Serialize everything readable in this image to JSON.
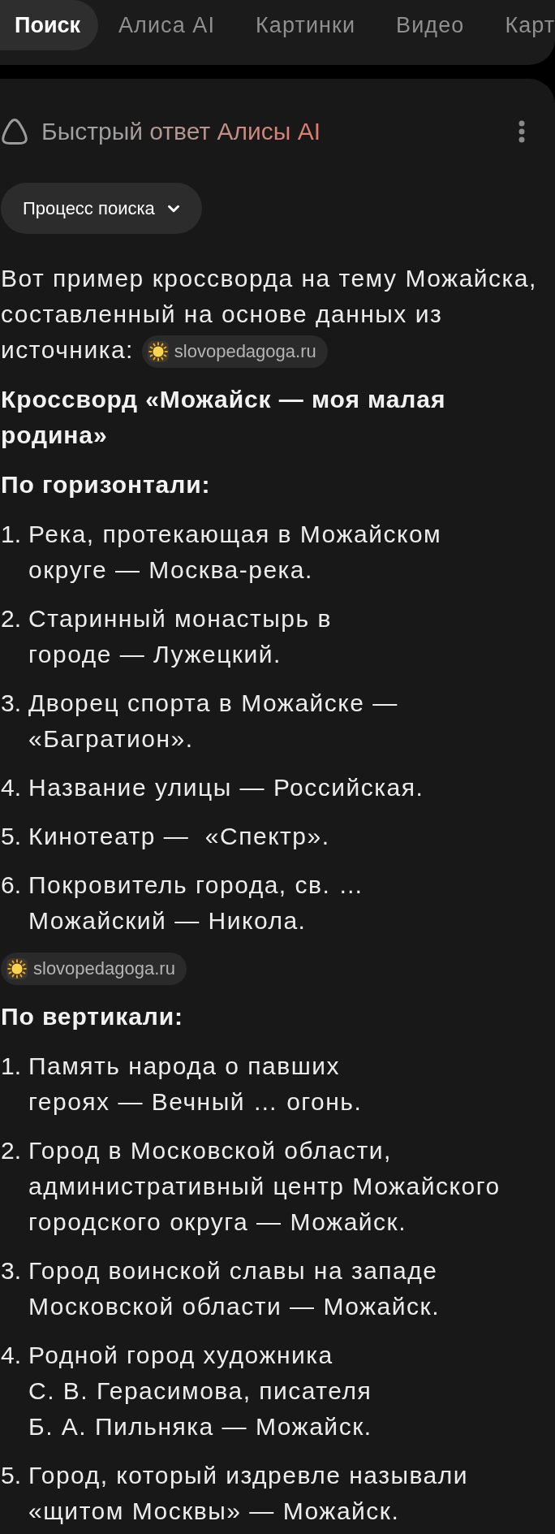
{
  "tabs": [
    {
      "label": "Поиск",
      "selected": true
    },
    {
      "label": "Алиса AI",
      "selected": false
    },
    {
      "label": "Картинки",
      "selected": false
    },
    {
      "label": "Видео",
      "selected": false
    },
    {
      "label": "Карт",
      "selected": false
    }
  ],
  "answer": {
    "title": "Быстрый ответ Алисы AI",
    "process_button": {
      "label": "Процесс поиска",
      "expanded": false
    },
    "blocks": [
      {
        "kind": "paragraph",
        "text": "Вот пример кроссворда на тему Можайска, составленный на основе данных из источника:",
        "source": "slovopedagoga.ru"
      },
      {
        "kind": "heading",
        "text": "Кроссворд «Можайск — моя малая родина»"
      },
      {
        "kind": "heading",
        "text": "По горизонтали:"
      },
      {
        "kind": "list",
        "items": [
          {
            "number": "1.",
            "text": "Река, протекающая в Можайском округе — Москва-река."
          },
          {
            "number": "2.",
            "text": "Старинный монастырь в городе — Лужецкий."
          },
          {
            "number": "3.",
            "text": "Дворец спорта в Можайске — «Багратион»."
          },
          {
            "number": "4.",
            "text": "Название улицы — Российская."
          },
          {
            "number": "5.",
            "text": "Кинотеатр —  «Спектр»."
          },
          {
            "number": "6.",
            "text": "Покровитель города, св. … Можайский — Никола."
          }
        ]
      },
      {
        "kind": "source",
        "label": "slovopedagoga.ru"
      },
      {
        "kind": "heading",
        "text": "По вертикали:"
      },
      {
        "kind": "list",
        "items": [
          {
            "number": "1.",
            "text": "Память народа о павших героях — Вечный … огонь."
          },
          {
            "number": "2.",
            "text": "Город в Московской области, административный центр Можайского городского округа — Можайск."
          },
          {
            "number": "3.",
            "text": "Город воинской славы на западе Московской области — Можайск."
          },
          {
            "number": "4.",
            "text": "Родной город художника С. В. Герасимова, писателя Б. А. Пильняка — Можайск."
          },
          {
            "number": "5.",
            "text": "Город, который издревле называли «щитом Москвы» — Можайск."
          }
        ]
      }
    ]
  }
}
